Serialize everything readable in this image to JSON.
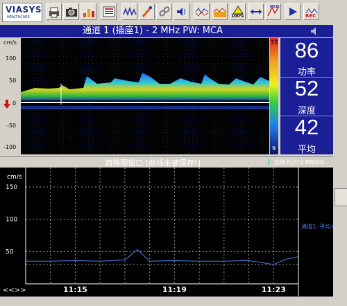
{
  "app": {
    "logo_text": "VIASYS",
    "logo_subtext": "HEALTHCARE"
  },
  "toolbar": {
    "icons": [
      "print-icon",
      "camera-icon",
      "channel-chart-icon",
      "report-icon",
      "waveform-icon",
      "marker-pen-icon",
      "link-icon",
      "volume-icon",
      "envelope-wave-icon",
      "spectrum-icon",
      "gain-100-icon",
      "width-arrows-icon",
      "mcd-icon",
      "play-icon",
      "rec-icon"
    ],
    "gain_label": "100%",
    "mcd_label": "MCD",
    "rec_label": "REC"
  },
  "channel": {
    "title": "通道 1 (插座1) - 2 MHz PW: MCA"
  },
  "spectrum": {
    "y_unit": "cm/s",
    "y_ticks": [
      "100",
      "50",
      "0",
      "-50",
      "-100"
    ],
    "scale_top": "33",
    "scale_bottom": "9"
  },
  "readouts": [
    {
      "value": "86",
      "label": "功率"
    },
    {
      "value": "52",
      "label": "深度"
    },
    {
      "value": "42",
      "label": "平均"
    }
  ],
  "trend": {
    "title": "趋势图窗口 [曲线未被保存!]",
    "file_size": "文件大小: 0 MB/0%",
    "y_unit": "cm/s",
    "y_ticks": [
      "150",
      "100",
      "50"
    ],
    "x_ticks": [
      "11:15",
      "11:19",
      "11:23"
    ],
    "legend": "通道1: 平均+",
    "nav_label": "<<>>",
    "line_color": "#4f7fe6"
  },
  "chart_data": {
    "type": "line",
    "title": "",
    "xlabel": "",
    "ylabel": "cm/s",
    "ylim": [
      0,
      180
    ],
    "x": [
      "11:13",
      "11:14",
      "11:15",
      "11:16",
      "11:17",
      "11:17:30",
      "11:18",
      "11:19",
      "11:20",
      "11:21",
      "11:22",
      "11:23",
      "11:23:30",
      "11:24"
    ],
    "series": [
      {
        "name": "通道1: 平均+",
        "values": [
          35,
          35,
          36,
          35,
          37,
          53,
          35,
          36,
          35,
          35,
          36,
          30,
          38,
          42
        ]
      }
    ]
  }
}
